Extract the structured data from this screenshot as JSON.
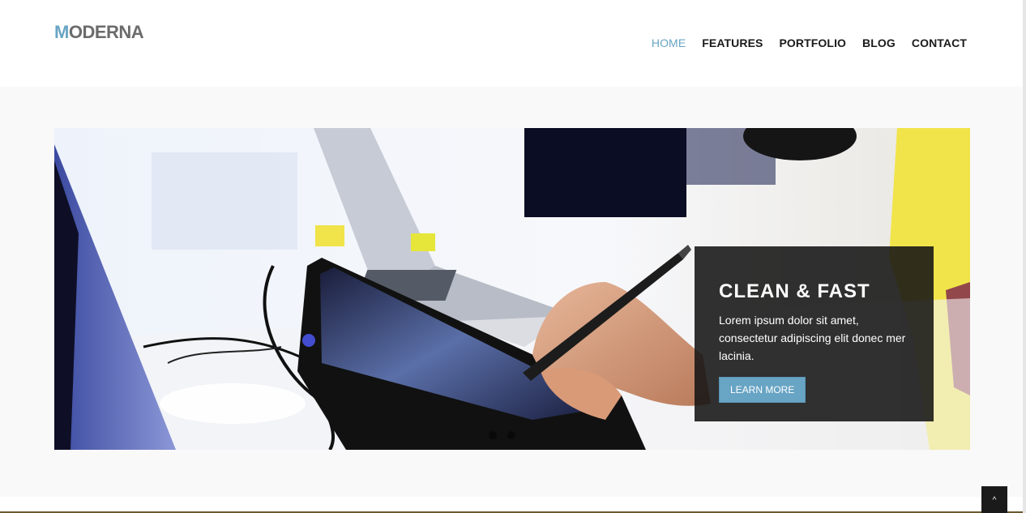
{
  "brand": {
    "first_letter": "M",
    "rest": "ODERNA"
  },
  "nav": {
    "items": [
      {
        "label": "HOME",
        "active": true
      },
      {
        "label": "FEATURES",
        "active": false
      },
      {
        "label": "PORTFOLIO",
        "active": false
      },
      {
        "label": "BLOG",
        "active": false
      },
      {
        "label": "CONTACT",
        "active": false
      }
    ]
  },
  "slider": {
    "caption": {
      "title": "CLEAN & FAST",
      "text": "Lorem ipsum dolor sit amet, consectetur adipiscing elit donec mer lacinia.",
      "button_label": "LEARN MORE"
    },
    "slide_count": 3,
    "active_slide": 3
  },
  "scroll_up": {
    "icon": "chevron-up-icon",
    "glyph": "^"
  },
  "colors": {
    "accent": "#68a4c4",
    "logo_gray": "#6b6b6b",
    "caption_bg": "#141414"
  }
}
